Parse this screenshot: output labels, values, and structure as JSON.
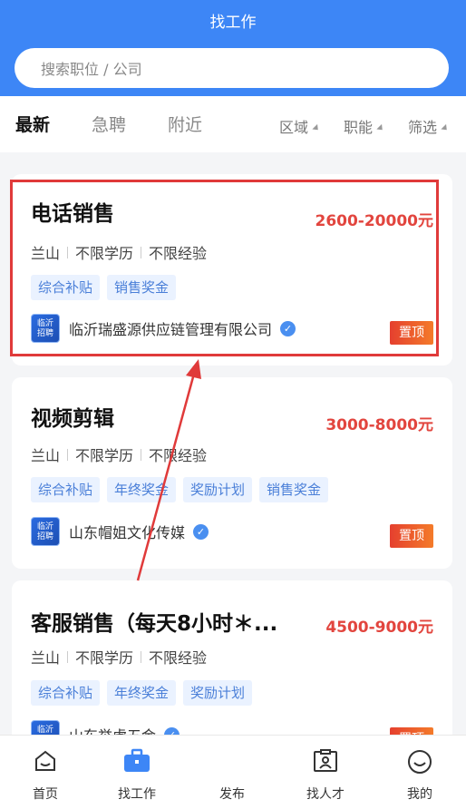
{
  "header": {
    "title": "找工作"
  },
  "search": {
    "placeholder": "搜索职位 / 公司"
  },
  "tabs": [
    {
      "label": "最新",
      "active": true
    },
    {
      "label": "急聘",
      "active": false
    },
    {
      "label": "附近",
      "active": false
    }
  ],
  "filters": [
    {
      "label": "区域"
    },
    {
      "label": "职能"
    },
    {
      "label": "筛选"
    }
  ],
  "jobs": [
    {
      "title": "电话销售",
      "salary": "2600-20000元",
      "location": "兰山",
      "education": "不限学历",
      "experience": "不限经验",
      "tags": [
        "综合补贴",
        "销售奖金"
      ],
      "company": "临沂瑞盛源供应链管理有限公司",
      "badge": "置顶"
    },
    {
      "title": "视频剪辑",
      "salary": "3000-8000元",
      "location": "兰山",
      "education": "不限学历",
      "experience": "不限经验",
      "tags": [
        "综合补贴",
        "年终奖金",
        "奖励计划",
        "销售奖金"
      ],
      "company": "山东帽姐文化传媒",
      "badge": "置顶"
    },
    {
      "title": "客服销售（每天8小时＊...",
      "salary": "4500-9000元",
      "location": "兰山",
      "education": "不限学历",
      "experience": "不限经验",
      "tags": [
        "综合补贴",
        "年终奖金",
        "奖励计划"
      ],
      "company": "山东举虎五金",
      "badge": "置顶"
    }
  ],
  "logo_text": "临沂招聘",
  "nav": [
    {
      "label": "首页",
      "icon": "home-icon"
    },
    {
      "label": "找工作",
      "icon": "briefcase-icon",
      "active": true
    },
    {
      "label": "发布",
      "icon": "publish-icon"
    },
    {
      "label": "找人才",
      "icon": "id-card-icon"
    },
    {
      "label": "我的",
      "icon": "smile-icon"
    }
  ],
  "colors": {
    "primary": "#3d86f6",
    "salary": "#e2453e",
    "highlight": "#e03a3a"
  }
}
